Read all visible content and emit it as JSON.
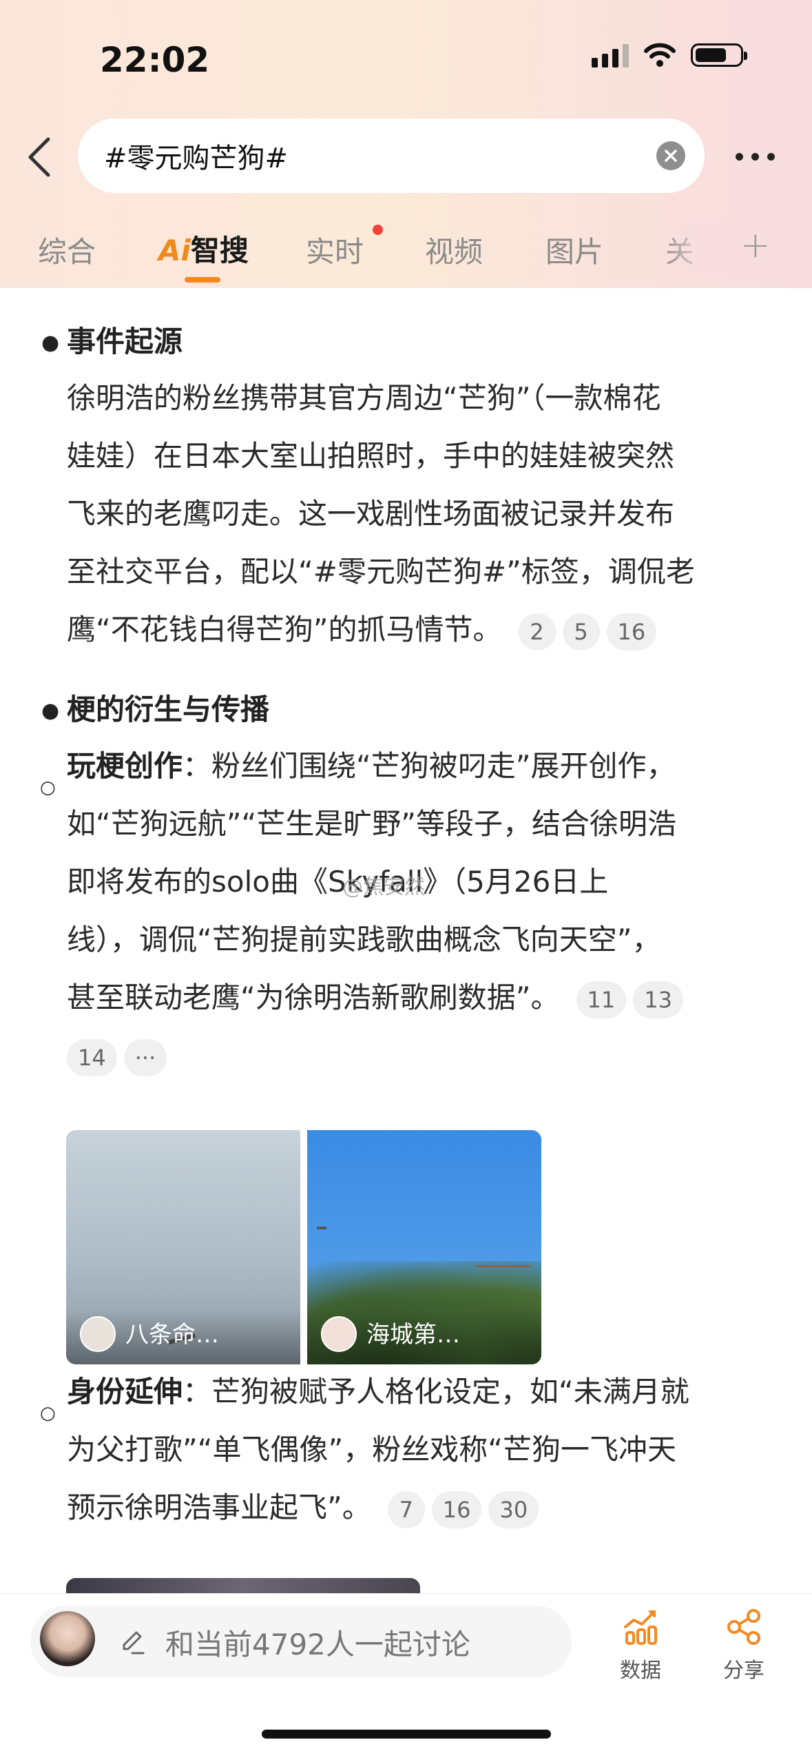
{
  "status_bar": {
    "time": "22:02"
  },
  "search": {
    "query": "#零元购芒狗#"
  },
  "tabs": [
    {
      "label": "综合"
    },
    {
      "label": "智搜",
      "prefix": "Ai"
    },
    {
      "label": "实时"
    },
    {
      "label": "视频"
    },
    {
      "label": "图片"
    },
    {
      "label": "关"
    }
  ],
  "content": {
    "section1": {
      "heading": "事件起源",
      "lines": [
        "徐明浩的粉丝携带其官方周边“芒狗”（一款棉花",
        "娃娃）在日本大室山拍照时，手中的娃娃被突然",
        "飞来的老鹰叼走。这一戏剧性场面被记录并发布",
        "至社交平台，配以“#零元购芒狗#”标签，调侃老",
        "鹰“不花钱白得芒狗”的抓马情节。"
      ],
      "refs": [
        "2",
        "5",
        "16"
      ]
    },
    "section2": {
      "heading": "梗的衍生与传播"
    },
    "sub1": {
      "label": "玩梗创作",
      "colon": "：",
      "lines": [
        "粉丝们围绕“芒狗被叼走”展开创作，",
        "如“芒狗远航”“芒生是旷野”等段子，结合徐明浩",
        "即将发布的solo曲《Skyfall》（5月26日上",
        "线），调侃“芒狗提前实践歌曲概念飞向天空”，",
        "甚至联动老鹰“为徐明浩新歌刷数据”。"
      ],
      "refs": [
        "11",
        "13",
        "14",
        "···"
      ]
    },
    "watermark": "@焦安然",
    "thumbs": [
      {
        "label": "八条命…"
      },
      {
        "label": "海城第…"
      }
    ],
    "sub2": {
      "label": "身份延伸",
      "colon": "：",
      "lines": [
        "芒狗被赋予人格化设定，如“未满月就",
        "为父打歌”“单飞偶像”，粉丝戏称“芒狗一飞冲天",
        "预示徐明浩事业起飞”。"
      ],
      "refs": [
        "7",
        "16",
        "30"
      ]
    }
  },
  "bottom_bar": {
    "comment_placeholder": "和当前4792人一起讨论",
    "data_label": "数据",
    "share_label": "分享"
  },
  "colors": {
    "accent": "#f5881f",
    "ai_orange": "#f08a1c",
    "dot_red": "#f44336"
  }
}
